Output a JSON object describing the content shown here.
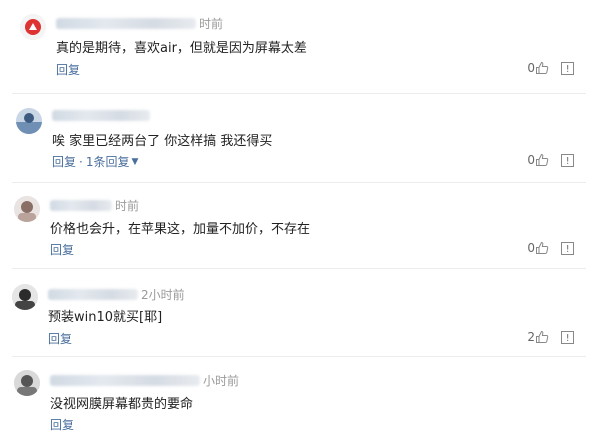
{
  "comments": [
    {
      "time": "时前",
      "text": "真的是期待，喜欢air，但就是因为屏幕太差",
      "reply_label": "回复",
      "replies_label": "",
      "likes": "0",
      "avatar_icon": "user-avatar"
    },
    {
      "time": "",
      "text": "唉 家里已经两台了 你这样搞 我还得买",
      "reply_label": "回复",
      "replies_label": "1条回复",
      "likes": "0",
      "avatar_icon": "user-avatar"
    },
    {
      "time": "时前",
      "text": "价格也会升，在苹果这，加量不加价，不存在",
      "reply_label": "回复",
      "replies_label": "",
      "likes": "0",
      "avatar_icon": "user-avatar"
    },
    {
      "time": "2小时前",
      "text": "预装win10就买[耶]",
      "reply_label": "回复",
      "replies_label": "",
      "likes": "2",
      "avatar_icon": "user-avatar"
    },
    {
      "time": "小时前",
      "text": "没视网膜屏幕都贵的要命",
      "reply_label": "回复",
      "replies_label": "",
      "likes": "",
      "avatar_icon": "user-avatar"
    }
  ],
  "colors": {
    "link": "#4a6f9c",
    "meta": "#a0a0a0",
    "separator": "#ececec"
  }
}
